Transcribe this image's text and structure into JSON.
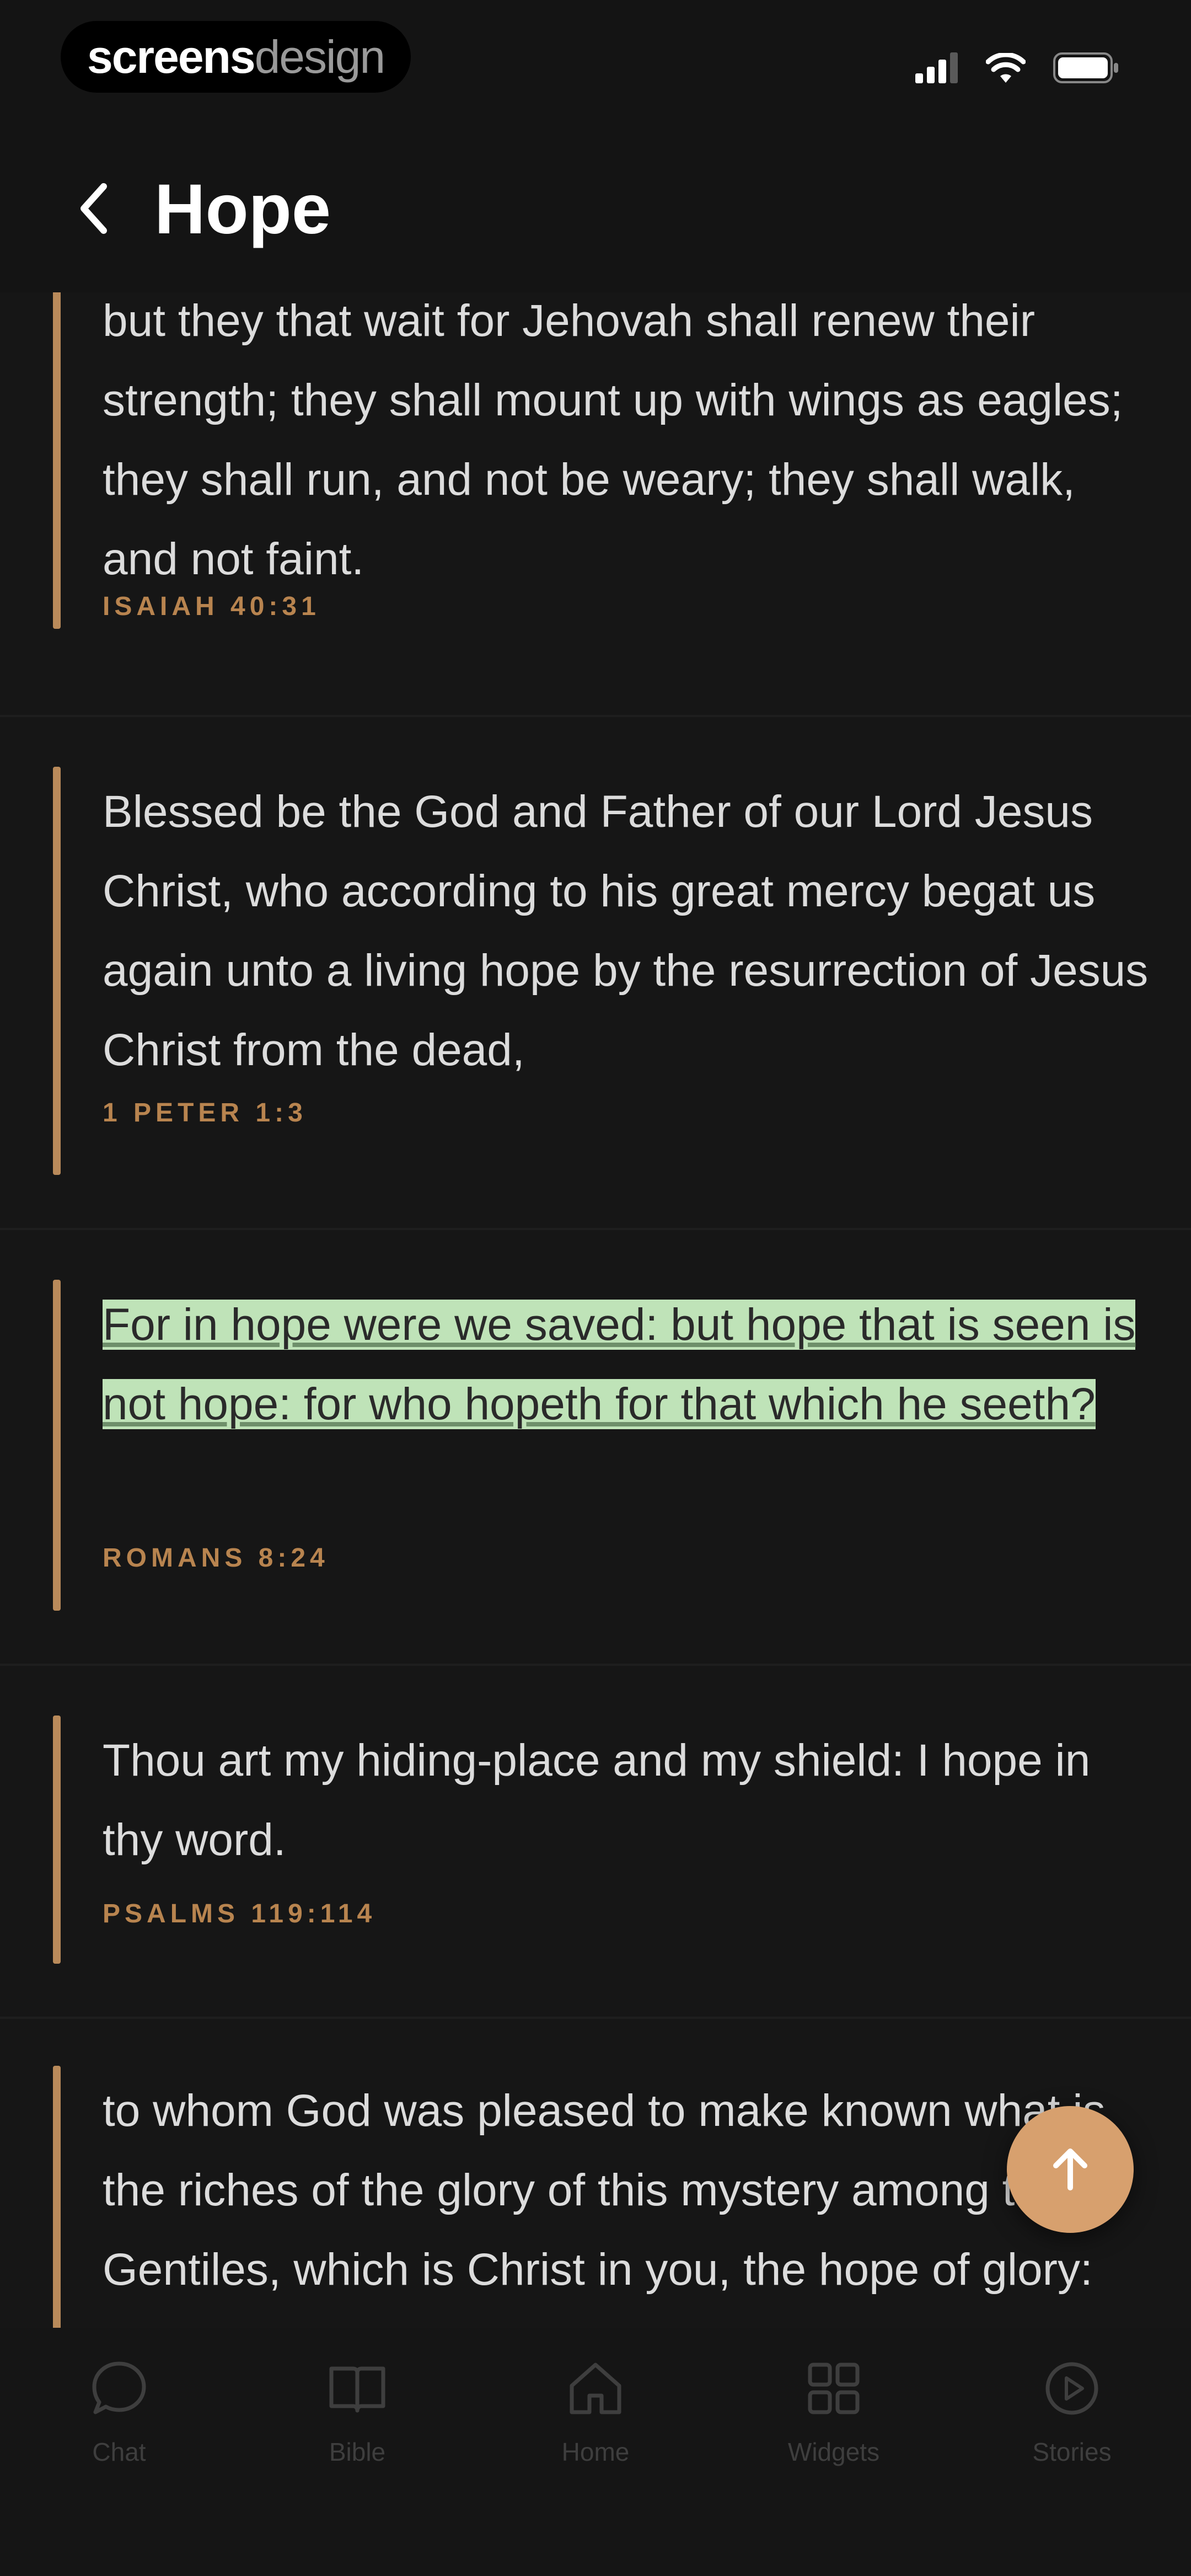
{
  "status_bar": {
    "watermark_bold": "screens",
    "watermark_light": "design",
    "icons": [
      "cellular-signal-icon",
      "wifi-icon",
      "battery-icon"
    ]
  },
  "header": {
    "back_icon": "chevron-left-icon",
    "title": "Hope"
  },
  "verses": [
    {
      "text": "but they that wait for Jehovah shall renew their strength; they shall mount up with wings as eagles; they shall run, and not be weary; they shall walk, and not faint.",
      "reference": "ISAIAH 40:31",
      "highlighted": false
    },
    {
      "text": "Blessed be the God and Father of our Lord Jesus Christ, who according to his great mercy begat us again unto a living hope by the resurrection of Jesus Christ from the dead,",
      "reference": "1 PETER 1:3",
      "highlighted": false
    },
    {
      "text": "For in hope were we saved: but hope that is seen is not hope: for who hopeth for that which he seeth?",
      "reference": "ROMANS 8:24",
      "highlighted": true
    },
    {
      "text": "Thou art my hiding-place and my shield: I hope in thy word.",
      "reference": "PSALMS 119:114",
      "highlighted": false
    },
    {
      "text": "to whom God was pleased to make known what is the riches of the glory of this mystery among the Gentiles, which is Christ in you, the hope of glory:",
      "reference": "",
      "highlighted": false
    }
  ],
  "fab": {
    "icon": "arrow-up-icon"
  },
  "tabs": [
    {
      "label": "Chat",
      "icon": "chat-bubble-icon"
    },
    {
      "label": "Bible",
      "icon": "book-icon"
    },
    {
      "label": "Home",
      "icon": "home-icon"
    },
    {
      "label": "Widgets",
      "icon": "grid-icon"
    },
    {
      "label": "Stories",
      "icon": "play-circle-icon"
    }
  ],
  "colors": {
    "background": "#161616",
    "accent": "#b98a5a",
    "reference": "#b8844f",
    "highlight": "#bfe3b8",
    "fab": "#d7a06e",
    "tab_inactive": "#3e3e3e"
  }
}
